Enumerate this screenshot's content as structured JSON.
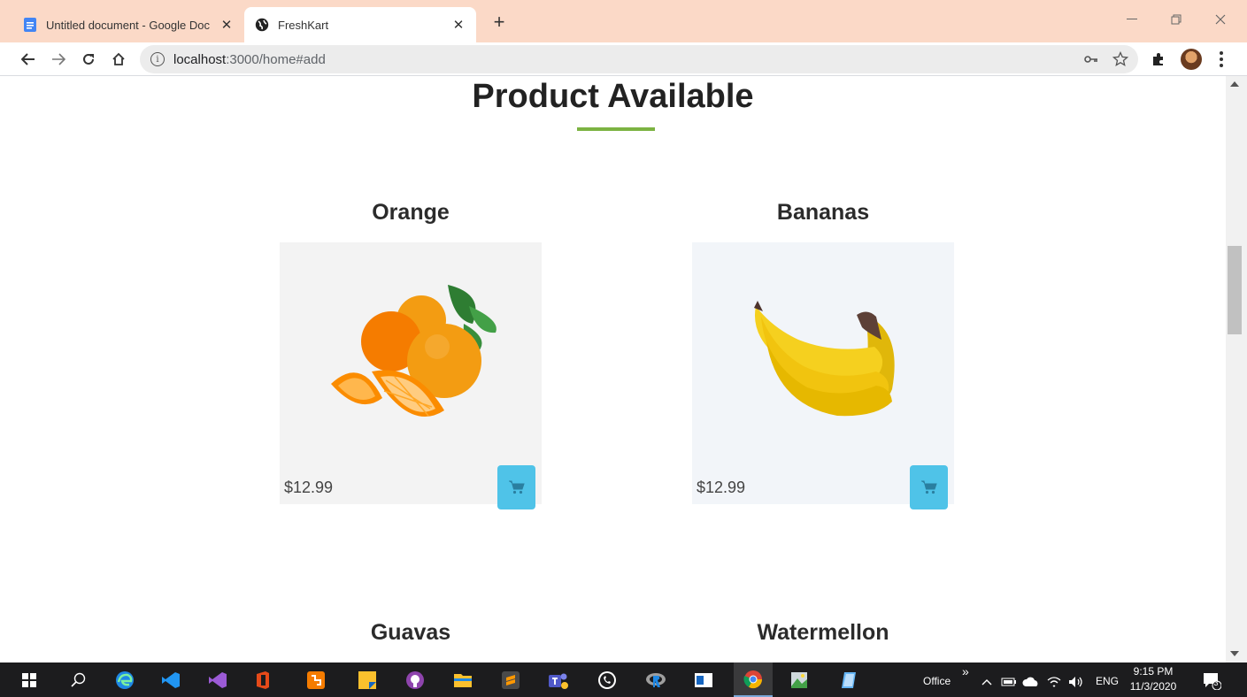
{
  "browser": {
    "tabs": [
      {
        "title": "Untitled document - Google Doc",
        "icon": "google-docs-icon",
        "active": false
      },
      {
        "title": "FreshKart",
        "icon": "globe-icon",
        "active": true
      }
    ],
    "close_glyph": "✕",
    "new_tab_glyph": "+",
    "url_host": "localhost",
    "url_rest": ":3000/home#add",
    "info_glyph": "i"
  },
  "page": {
    "heading": "Product Available",
    "accent_color": "#7cb342",
    "cart_color": "#4fc3e8",
    "products": [
      {
        "name": "Orange",
        "price": "$12.99"
      },
      {
        "name": "Bananas",
        "price": "$12.99"
      },
      {
        "name": "Guavas"
      },
      {
        "name": "Watermellon"
      }
    ]
  },
  "taskbar": {
    "office_label": "Office",
    "chevron": "»",
    "lang": "ENG",
    "time": "9:15 PM",
    "date": "11/3/2020",
    "notification_count": "3"
  }
}
